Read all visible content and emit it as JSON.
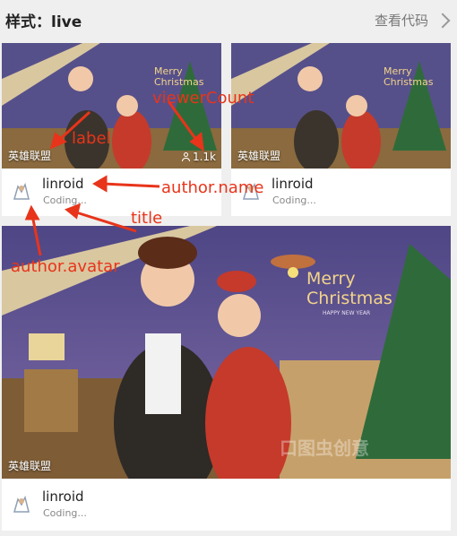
{
  "header": {
    "title": "样式：live",
    "view_code": "查看代码"
  },
  "cards": [
    {
      "label": "英雄联盟",
      "viewer_count": "1.1k",
      "author_name": "linroid",
      "title": "Coding...",
      "cover_text": "Merry Christmas"
    },
    {
      "label": "英雄联盟",
      "author_name": "linroid",
      "title": "Coding...",
      "cover_text": "Merry Christmas"
    },
    {
      "label": "英雄联盟",
      "author_name": "linroid",
      "title": "Coding...",
      "cover_text": "Merry Christmas",
      "cover_subtitle": "HAPPY NEW YEAR",
      "watermark": "口图虫创意"
    }
  ],
  "annotations": {
    "label": "label",
    "viewer_count": "viewerCount",
    "author_name": "author.name",
    "title": "title",
    "author_avatar": "author.avatar"
  },
  "colors": {
    "annotation": "#e8341a",
    "sky": "#5a4e8c",
    "tree": "#2f6b3a",
    "red_jacket": "#c53a2b"
  }
}
